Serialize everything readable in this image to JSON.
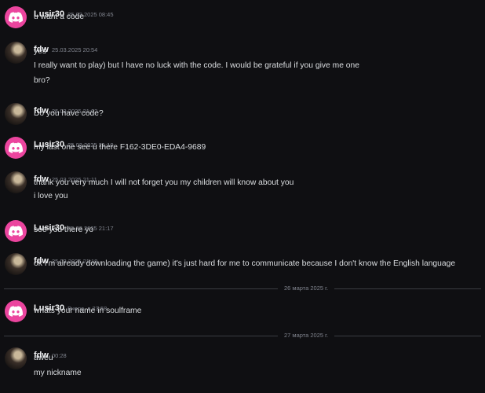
{
  "colors": {
    "background": "#0f0f12",
    "discord_avatar": "#eb459e",
    "author_text": "#f2f3f5",
    "message_text": "#dbdee1",
    "timestamp_text": "#80848e"
  },
  "messages": [
    {
      "author": "Lusir30",
      "time": "25.03.2025 08:45",
      "avatar": "discord-logo-icon",
      "lines": [
        "u want a code"
      ]
    },
    {
      "author": "fdw",
      "time": "25.03.2025 20:54",
      "avatar": "user-photo",
      "lines": [
        "yes",
        "I really want to play) but I have no luck with the code. I would be grateful if you give me one",
        "bro?"
      ]
    },
    {
      "author": "fdw",
      "time": "25.03.2025 21:02",
      "avatar": "user-photo",
      "lines": [
        "Do you have  code?"
      ]
    },
    {
      "author": "Lusir30",
      "time": "25.03.2025 21:10",
      "avatar": "discord-logo-icon",
      "lines": [
        "my last one see u there F162-3DE0-EDA4-9689"
      ]
    },
    {
      "author": "fdw",
      "time": "25.03.2025 21:11",
      "avatar": "user-photo",
      "lines": [
        "thank you very much I will not forget you my children will know about you",
        "i love you"
      ]
    },
    {
      "author": "Lusir30",
      "time": "25.03.2025 21:17",
      "avatar": "discord-logo-icon",
      "lines": [
        "see you there yo"
      ]
    },
    {
      "author": "fdw",
      "time": "25.03.2025 21:18",
      "avatar": "user-photo",
      "lines": [
        "ok I'm already downloading the game) it's just hard for me to communicate because I don't know the English language"
      ]
    },
    {
      "author": "Lusir30",
      "time": "Вчера, в 23:58",
      "avatar": "discord-logo-icon",
      "lines": [
        "whats your name in soulframe"
      ]
    },
    {
      "author": "fdw",
      "time": "00:28",
      "avatar": "user-photo",
      "lines": [
        "aweu",
        "my nickname"
      ]
    }
  ],
  "dividers": [
    {
      "label": "26 марта 2025 г."
    },
    {
      "label": "27 марта 2025 г."
    }
  ]
}
